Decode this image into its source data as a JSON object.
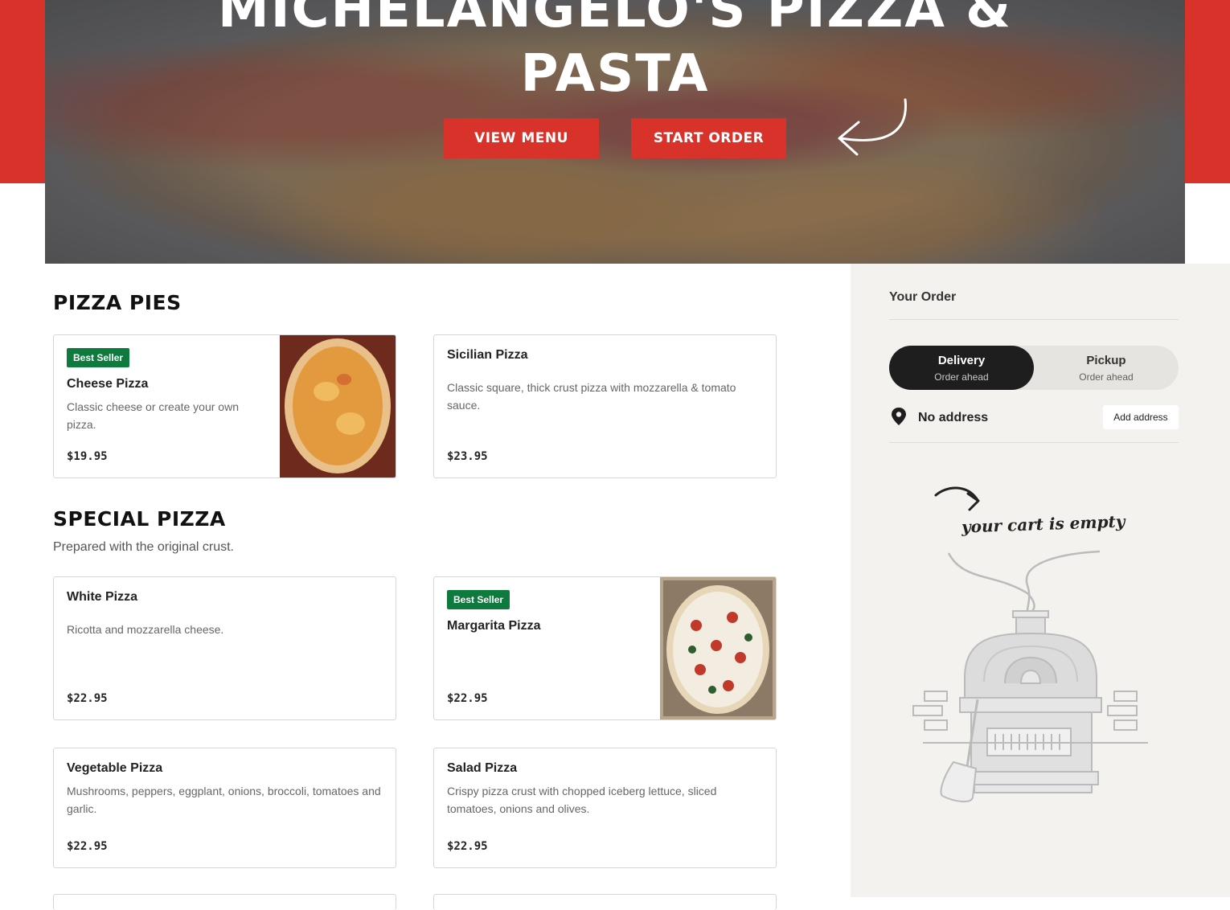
{
  "hero": {
    "title_line1": "MICHELANGELO'S PIZZA &",
    "title_line2": "PASTA",
    "view_menu_label": "VIEW MENU",
    "start_order_label": "START ORDER"
  },
  "sections": {
    "pizza_pies": {
      "title": "PIZZA PIES",
      "items": [
        {
          "badge": "Best Seller",
          "name": "Cheese Pizza",
          "description": "Classic cheese or create your own pizza.",
          "price": "$19.95"
        },
        {
          "name": "Sicilian Pizza",
          "description": "Classic square, thick crust pizza with mozzarella & tomato sauce.",
          "price": "$23.95"
        }
      ]
    },
    "special_pizza": {
      "title": "SPECIAL PIZZA",
      "subtitle": "Prepared with the original crust.",
      "items": [
        {
          "name": "White Pizza",
          "description": "Ricotta and mozzarella cheese.",
          "price": "$22.95"
        },
        {
          "badge": "Best Seller",
          "name": "Margarita Pizza",
          "price": "$22.95"
        },
        {
          "name": "Vegetable Pizza",
          "description": "Mushrooms, peppers, eggplant, onions, broccoli, tomatoes and garlic.",
          "price": "$22.95"
        },
        {
          "name": "Salad Pizza",
          "description": "Crispy pizza crust with chopped iceberg lettuce, sliced tomatoes, onions and olives.",
          "price": "$22.95"
        }
      ]
    }
  },
  "order": {
    "title": "Your Order",
    "delivery_label": "Delivery",
    "delivery_sub": "Order ahead",
    "pickup_label": "Pickup",
    "pickup_sub": "Order ahead",
    "address_text": "No address",
    "add_address_label": "Add address",
    "empty_cart_text": "your cart is empty"
  },
  "colors": {
    "brand_red": "#d8322b",
    "badge_green": "#0f7a3d",
    "toggle_dark": "#1e1e1e",
    "sidebar_bg": "#f3f2ef"
  }
}
